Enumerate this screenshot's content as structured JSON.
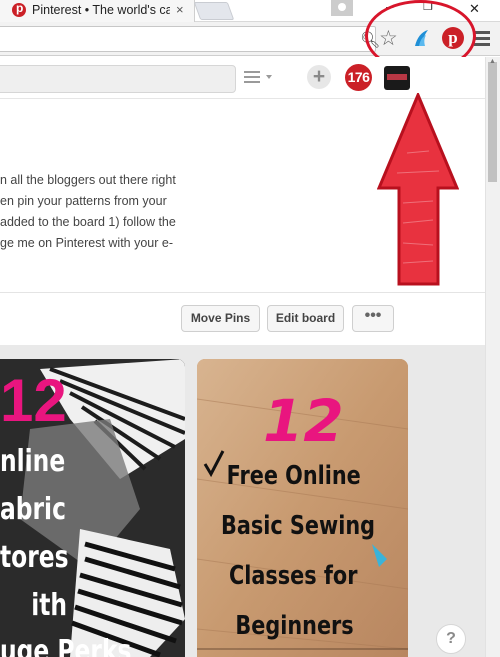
{
  "tab": {
    "title": "Pinterest • The world's cat",
    "close": "×"
  },
  "window": {
    "minimize": "–",
    "restore": "❐",
    "close": "✕"
  },
  "toolbar": {
    "zoom_icon": "magnifier-icon",
    "star_icon": "bookmark-star-icon",
    "extension_1": "blue-wing-icon",
    "extension_2": "pinterest-icon",
    "pinterest_glyph": "p",
    "menu_icon": "hamburger-icon"
  },
  "header": {
    "notification_count": "176",
    "plus": "+"
  },
  "board": {
    "description_lines": [
      "n all the bloggers out there right",
      "en pin your patterns from your",
      "added to the board 1) follow the",
      "ge me on Pinterest with your e-"
    ]
  },
  "actions": {
    "move_pins": "Move Pins",
    "edit_board": "Edit board",
    "more": "•••"
  },
  "pins": [
    {
      "number": "12",
      "lines": [
        "nline",
        "abric",
        "tores",
        "ith",
        "uge Perks"
      ]
    },
    {
      "number": "12",
      "lines": [
        "Free Online",
        "Basic Sewing",
        "Classes for",
        "Beginners"
      ]
    }
  ],
  "help": "?",
  "colors": {
    "pinterest_red": "#cb2027",
    "annotation_red": "#d8152b",
    "pin_pink": "#e9157f"
  }
}
